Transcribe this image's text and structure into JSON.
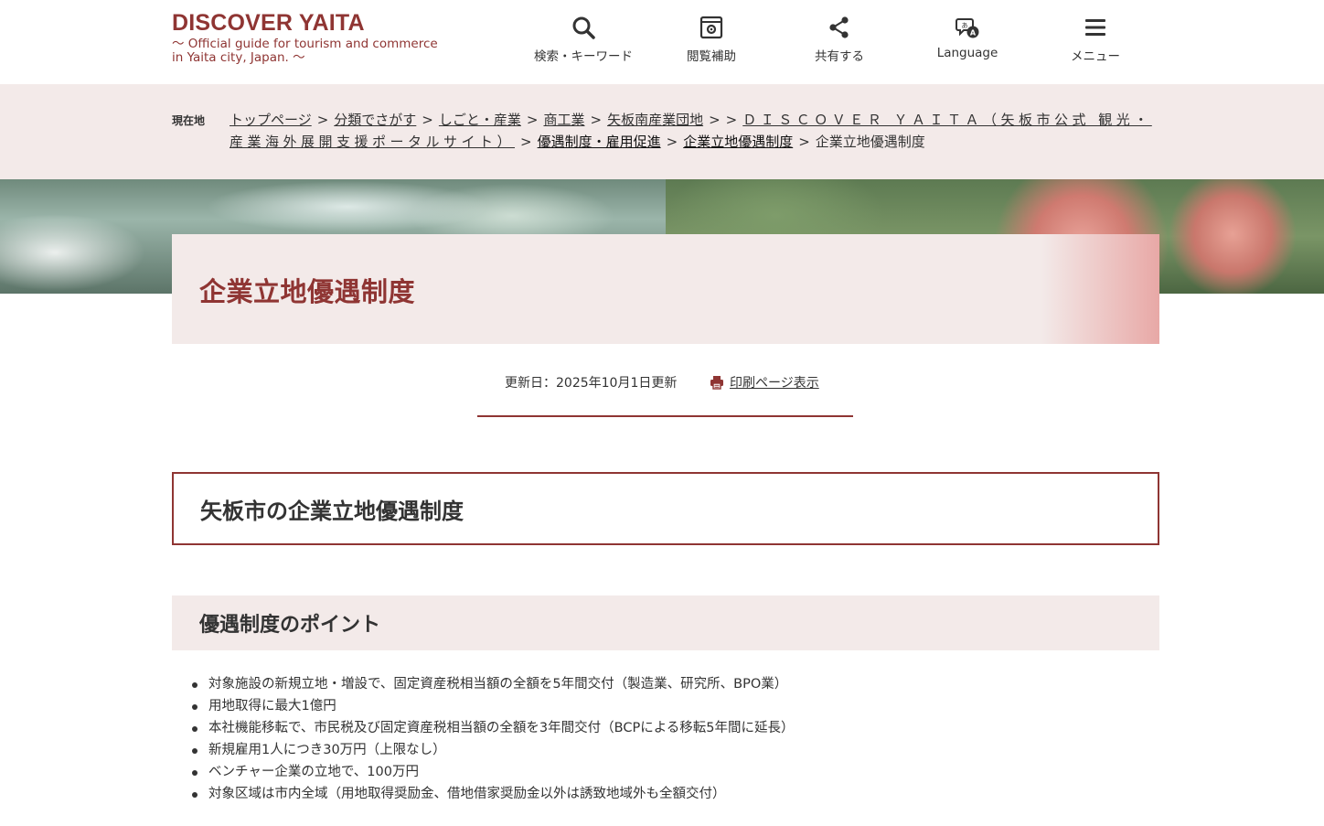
{
  "site": {
    "title": "DISCOVER YAITA",
    "subtitle": "～ Official guide for tourism and commerce\nin Yaita city, Japan. ～"
  },
  "nav": [
    {
      "label": "検索・キーワード",
      "icon": "search-icon"
    },
    {
      "label": "閲覧補助",
      "icon": "accessibility-icon"
    },
    {
      "label": "共有する",
      "icon": "share-icon"
    },
    {
      "label": "Language",
      "icon": "language-icon"
    },
    {
      "label": "メニュー",
      "icon": "menu-icon"
    }
  ],
  "breadcrumb": {
    "label": "現在地",
    "sep": ">",
    "items": [
      "トップページ",
      "分類でさがす",
      "しごと・産業",
      "商工業",
      "矢板南産業団地",
      "",
      "ＤＩＳＣＯＶＥＲ ＹＡＩＴＡ（矢板市公式 観光・産業海外展開支援ポータルサイト）",
      "優遇制度・雇用促進",
      "企業立地優遇制度"
    ],
    "current": "企業立地優遇制度"
  },
  "page": {
    "title": "企業立地優遇制度",
    "updated": "更新日：2025年10月1日更新",
    "print_label": "印刷ページ表示",
    "heading": "矢板市の企業立地優遇制度",
    "subheading": "優遇制度のポイント",
    "points": [
      "対象施設の新規立地・増設で、固定資産税相当額の全額を5年間交付（製造業、研究所、BPO業）",
      "用地取得に最大1億円",
      "本社機能移転で、市民税及び固定資産税相当額の全額を3年間交付（BCPによる移転5年間に延長）",
      "新規雇用1人につき30万円（上限なし）",
      "ベンチャー企業の立地で、100万円",
      "対象区域は市内全域（用地取得奨励金、借地借家奨励金以外は誘致地域外も全額交付）"
    ]
  },
  "colors": {
    "brand": "#8f3533",
    "band": "#f3eae9",
    "text": "#333333"
  }
}
